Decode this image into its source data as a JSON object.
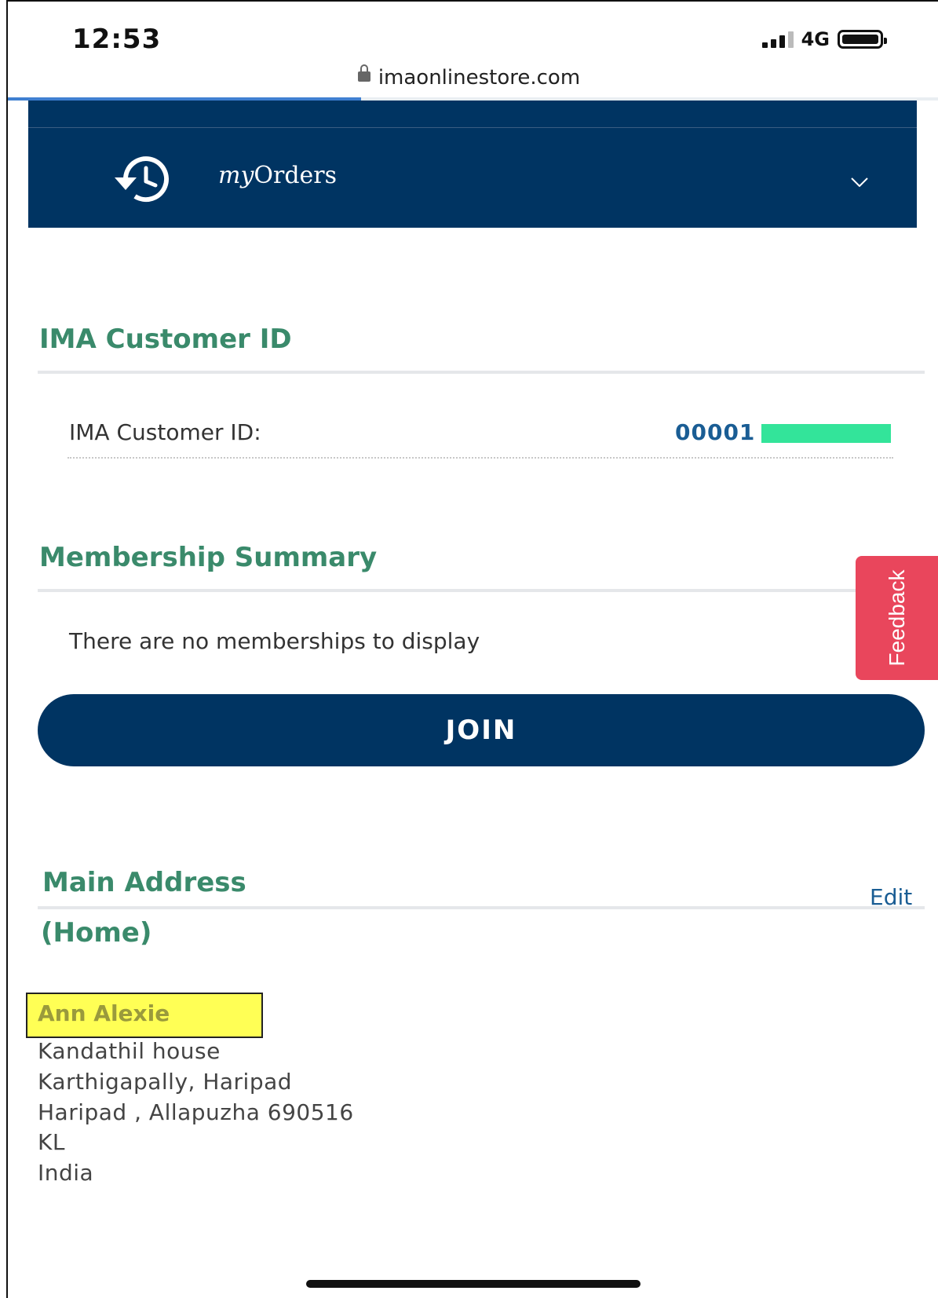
{
  "status_bar": {
    "time": "12:53",
    "network": "4G"
  },
  "browser": {
    "url": "imaonlinestore.com",
    "load_progress": 0.38
  },
  "nav": {
    "orders_prefix": "my",
    "orders_suffix": "Orders"
  },
  "customer_id_section": {
    "title": "IMA Customer ID",
    "label": "IMA Customer ID:",
    "value_visible": "00001"
  },
  "membership_section": {
    "title": "Membership Summary",
    "empty_message": "There are no memberships to display",
    "join_label": "JOIN"
  },
  "feedback_tab": {
    "label": "Feedback"
  },
  "address_section": {
    "title_line1": "Main Address",
    "title_line2": "(Home)",
    "edit_label": "Edit",
    "name": "Ann Alexie",
    "lines": [
      "Kandathil house",
      "Karthigapally, Haripad",
      "Haripad , Allapuzha 690516",
      "KL",
      "India"
    ]
  },
  "colors": {
    "navy": "#003462",
    "section_green": "#3a8a6b",
    "link_blue": "#1a5d94",
    "feedback_red": "#e9465c",
    "highlight_yellow": "#ffff55",
    "redaction_green": "#33e49a"
  },
  "icons": {
    "orders": "history-clock-icon",
    "chevron": "chevron-down-icon",
    "lock": "lock-icon"
  }
}
